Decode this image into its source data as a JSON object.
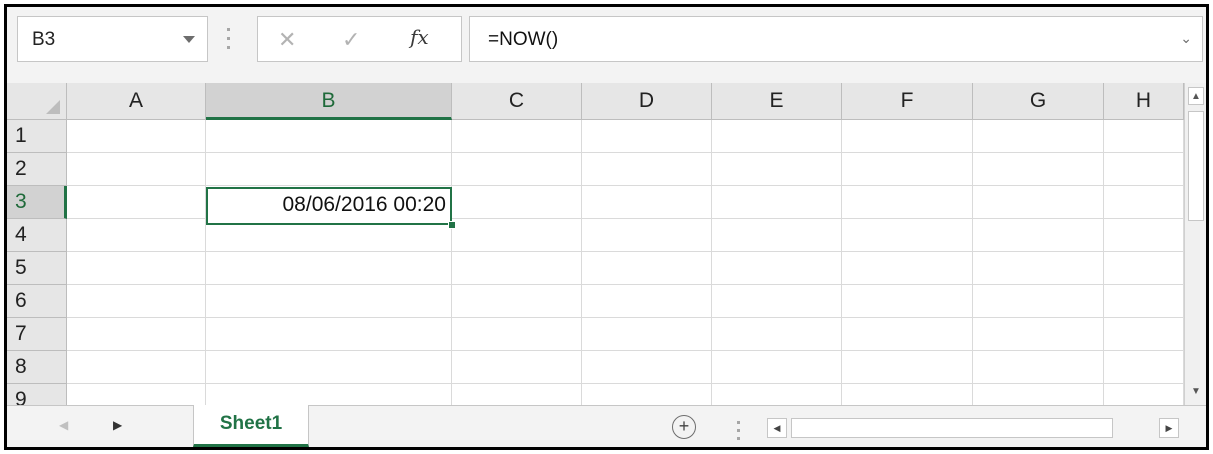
{
  "formula_bar": {
    "name_box": "B3",
    "formula": "=NOW()",
    "cancel_glyph": "✕",
    "enter_glyph": "✓",
    "fx_label": "fx",
    "expand_glyph": "⌄"
  },
  "grid": {
    "columns": [
      "A",
      "B",
      "C",
      "D",
      "E",
      "F",
      "G",
      "H"
    ],
    "selected_column": "B",
    "rows": [
      "1",
      "2",
      "3",
      "4",
      "5",
      "6",
      "7",
      "8",
      "9"
    ],
    "selected_row": "3",
    "active_cell": {
      "ref": "B3",
      "value": "08/06/2016 00:20"
    }
  },
  "tabs": {
    "sheets": [
      {
        "label": "Sheet1",
        "active": true
      }
    ],
    "add_glyph": "+",
    "prev_glyph": "◀",
    "next_glyph": "▶"
  },
  "scrollbars": {
    "up_glyph": "▲",
    "down_glyph": "▼",
    "left_glyph": "◀",
    "right_glyph": "▶"
  },
  "colors": {
    "accent": "#217346",
    "header_bg": "#e6e6e6",
    "gridline": "#dadada"
  }
}
